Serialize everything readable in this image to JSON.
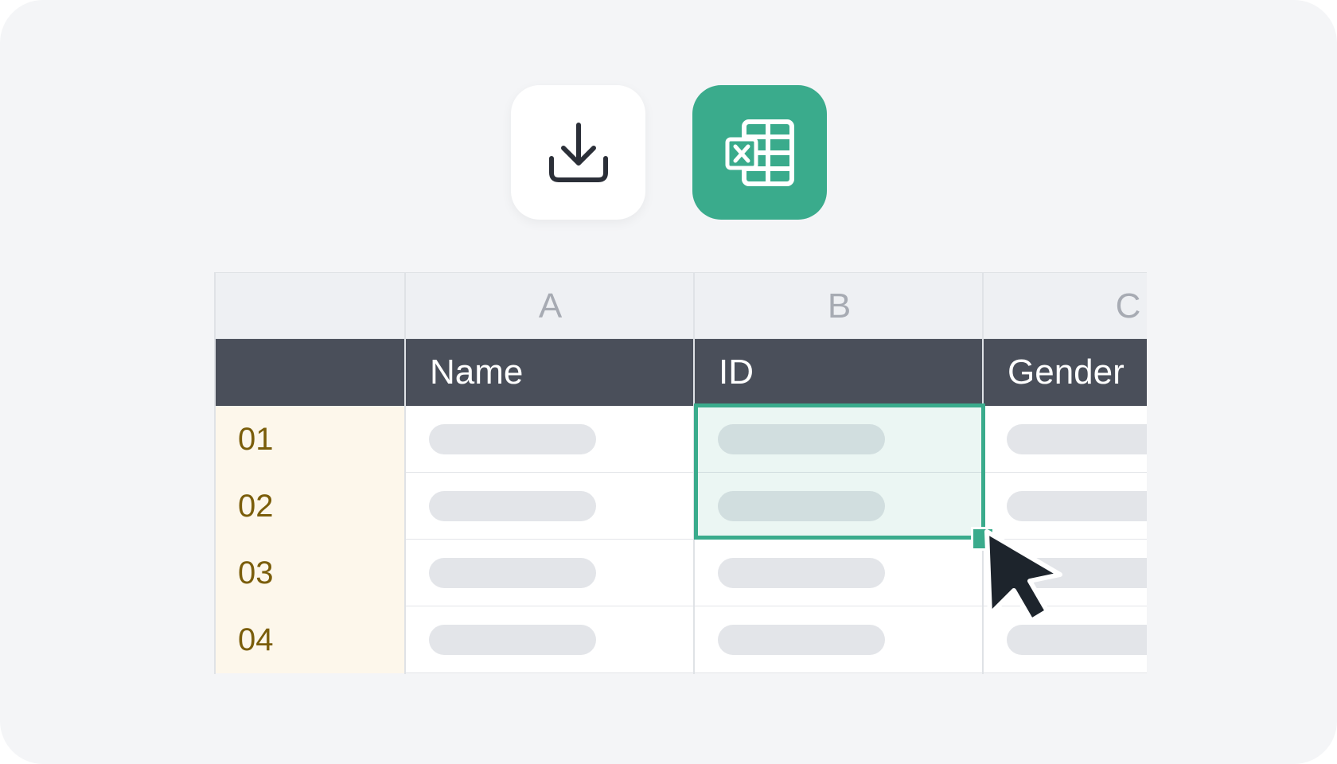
{
  "toolbar": {
    "download_icon": "download-icon",
    "excel_icon": "excel-icon",
    "excel_color": "#3aab8c"
  },
  "sheet": {
    "column_letters": [
      "A",
      "B",
      "C"
    ],
    "headers": [
      "Name",
      "ID",
      "Gender"
    ],
    "rows": [
      "01",
      "02",
      "03",
      "04"
    ],
    "selected_range": {
      "column": "B",
      "rows": [
        "01",
        "02"
      ]
    },
    "header_color": "#4a4f5a",
    "row_number_color": "#7a5d0a"
  },
  "cursor_icon": "arrow-cursor-icon"
}
